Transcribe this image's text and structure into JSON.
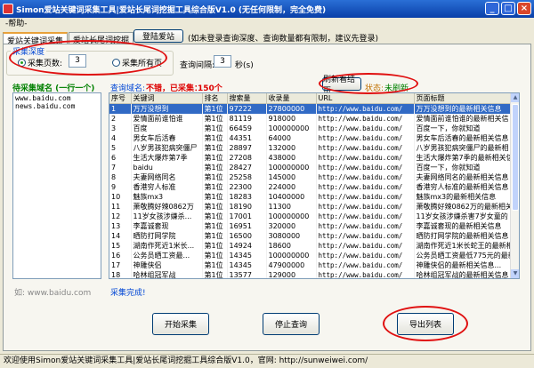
{
  "window": {
    "title": "Simon爱站关键词采集工具|爱站长尾词挖掘工具综合版V1.0 (无任何限制，完全免费)"
  },
  "menu": {
    "help": "-帮助-"
  },
  "tabs": [
    {
      "label": "爱站关键词采集"
    },
    {
      "label": "爱站长尾词挖掘"
    }
  ],
  "toolbar": {
    "login_button": "登陆爱站",
    "login_note": "(如未登录查询深度、查询数量都有限制，建议先登录)"
  },
  "collect_depth": {
    "legend": "采集深度",
    "pages_label": "采集页数:",
    "pages_value": "3",
    "all_pages_label": "采集所有页"
  },
  "interval": {
    "label": "查询间隔:",
    "value": "3",
    "unit": "秒(s)"
  },
  "refresh_button": "刷新看结页",
  "status": {
    "label": "状态:",
    "value": "未刷新"
  },
  "domain_section": {
    "title": "待采集域名 (一行一个)",
    "domains": [
      "www.baidu.com",
      "news.baidu.com"
    ],
    "example": "如: www.baidu.com"
  },
  "query_summary": {
    "domain_label": "查询域名:",
    "included_label": "不错，已采集：",
    "count": "150个"
  },
  "collect_done": "采集完成!",
  "table": {
    "columns": [
      "序号",
      "关键词",
      "排名",
      "搜索量",
      "收录量",
      "URL",
      "页面标题"
    ],
    "rows": [
      [
        "1",
        "万万没想到",
        "第1位",
        "97222",
        "27800000",
        "http://www.baidu.com/",
        "万万没想到的最新相关信息"
      ],
      [
        "2",
        "爱情面前谁怕谁",
        "第1位",
        "81119",
        "918000",
        "http://www.baidu.com/",
        "爱情面前谁怕谁的最新相关信"
      ],
      [
        "3",
        "百度",
        "第1位",
        "66459",
        "100000000",
        "http://www.baidu.com/",
        "百度一下，你就知道"
      ],
      [
        "4",
        "男女车后活春",
        "第1位",
        "44351",
        "64000",
        "http://www.baidu.com/",
        "男女车后活春的最新相关信息"
      ],
      [
        "5",
        "八岁男孩犯病突僵尸",
        "第1位",
        "28897",
        "132000",
        "http://www.baidu.com/",
        "八岁男孩犯病突僵尸的最新相"
      ],
      [
        "6",
        "生活大爆炸第7季",
        "第1位",
        "27208",
        "438000",
        "http://www.baidu.com/",
        "生活大爆炸第7季的最新相关信"
      ],
      [
        "7",
        "baidu",
        "第1位",
        "28427",
        "100000000",
        "http://www.baidu.com/",
        "百度一下，你就知道"
      ],
      [
        "8",
        "夫妻网络同名",
        "第1位",
        "25258",
        "145000",
        "http://www.baidu.com/",
        "夫妻网络同名的最新相关信息"
      ],
      [
        "9",
        "香港穷人标准",
        "第1位",
        "22300",
        "224000",
        "http://www.baidu.com/",
        "香港穷人标准的最新相关信息"
      ],
      [
        "10",
        "魅族mx3",
        "第1位",
        "18283",
        "10400000",
        "http://www.baidu.com/",
        "魅族mx3的最新相关信息"
      ],
      [
        "11",
        "萧敬腾好辣0862万",
        "第1位",
        "18190",
        "11300",
        "http://www.baidu.com/",
        "萧敬腾好辣0862万的最新相关"
      ],
      [
        "12",
        "11岁女孩涉嫌杀...",
        "第1位",
        "17001",
        "100000000",
        "http://www.baidu.com/",
        "11岁女孩涉嫌杀害7岁女童的"
      ],
      [
        "13",
        "李嘉诚套现",
        "第1位",
        "16951",
        "320000",
        "http://www.baidu.com/",
        "李嘉诚套现的最新相关信息"
      ],
      [
        "14",
        "晒防打网学院",
        "第1位",
        "16500",
        "3080000",
        "http://www.baidu.com/",
        "晒防打网学院的最新相关信息"
      ],
      [
        "15",
        "湖南作死近1米长...",
        "第1位",
        "14924",
        "18600",
        "http://www.baidu.com/",
        "湖南作死近1米长蛇王的最新相"
      ],
      [
        "16",
        "公务员晒工资最...",
        "第1位",
        "14345",
        "100000000",
        "http://www.baidu.com/",
        "公务员晒工资最低775元的最新"
      ],
      [
        "17",
        "神雕侠侣",
        "第1位",
        "14345",
        "47900000",
        "http://www.baidu.com/",
        "神雕侠侣的最新相关信息..."
      ],
      [
        "18",
        "哈林组冠军战",
        "第1位",
        "13577",
        "129000",
        "http://www.baidu.com/",
        "哈林组冠军战的最新相关信息"
      ]
    ]
  },
  "buttons": {
    "start": "开始采集",
    "stop": "停止查询",
    "export": "导出列表"
  },
  "statusbar": "欢迎使用Simon爱站关键词采集工具|爱站长尾词挖掘工具综合版V1.0，官网: http://sunweiwei.com/",
  "colors": {
    "title_bar": "#0a3fa8",
    "selected_row": "#316ac5",
    "annotation_ring": "#e01010"
  }
}
